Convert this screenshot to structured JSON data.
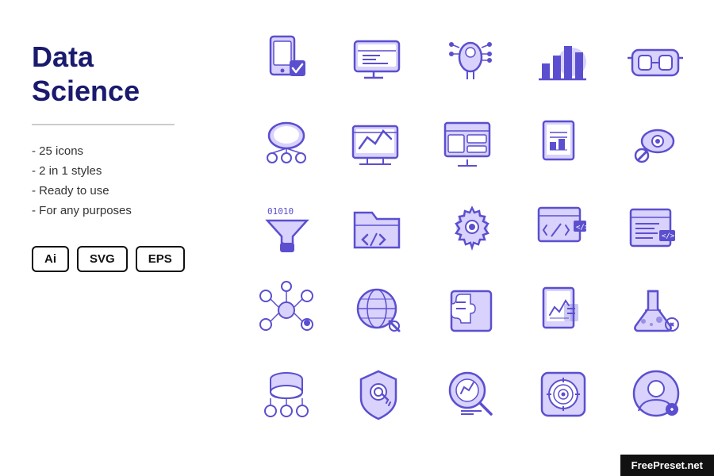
{
  "left": {
    "title": "Data\nScience",
    "divider": true,
    "features": [
      "- 25 icons",
      "- 2 in 1 styles",
      "- Ready to use",
      "- For any purposes"
    ],
    "badges": [
      "Ai",
      "SVG",
      "EPS"
    ]
  },
  "watermark": {
    "text": "FreePreset.net",
    "highlight": "FreePreset"
  },
  "accent_color": "#7b6cf6",
  "accent_light": "#c9c0fa",
  "dark_color": "#1a1a6e"
}
